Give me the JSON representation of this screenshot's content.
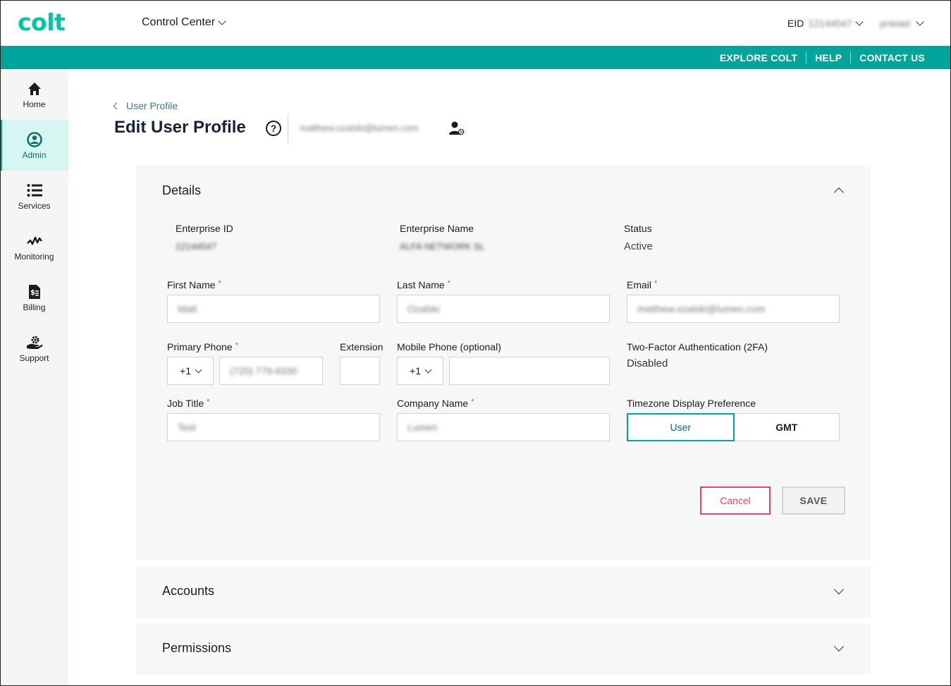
{
  "header": {
    "logo": "colt",
    "app_switcher": "Control Center",
    "eid_label": "EID",
    "eid_value": "12144547",
    "user_name": "prasad"
  },
  "top_links": [
    "EXPLORE COLT",
    "HELP",
    "CONTACT US"
  ],
  "sidebar": {
    "items": [
      {
        "label": "Home",
        "icon": "home-icon",
        "active": false
      },
      {
        "label": "Admin",
        "icon": "user-circle-icon",
        "active": true
      },
      {
        "label": "Services",
        "icon": "list-icon",
        "active": false
      },
      {
        "label": "Monitoring",
        "icon": "pulse-icon",
        "active": false
      },
      {
        "label": "Billing",
        "icon": "invoice-icon",
        "active": false
      },
      {
        "label": "Support",
        "icon": "support-icon",
        "active": false
      }
    ]
  },
  "page": {
    "breadcrumb": "User Profile",
    "title": "Edit User Profile",
    "help_glyph": "?",
    "user_email": "matthew.ozalski@lumen.com"
  },
  "details": {
    "title": "Details",
    "enterprise_id_label": "Enterprise ID",
    "enterprise_id_value": "12144547",
    "enterprise_name_label": "Enterprise Name",
    "enterprise_name_value": "ALFA NETWORK SL",
    "status_label": "Status",
    "status_value": "Active",
    "first_name_label": "First Name",
    "first_name_value": "Matt",
    "last_name_label": "Last Name",
    "last_name_value": "Ozalski",
    "email_label": "Email",
    "email_value": "matthew.ozalski@lumen.com",
    "primary_phone_label": "Primary Phone",
    "primary_phone_code": "+1",
    "primary_phone_value": "(720) 779-6330",
    "extension_label": "Extension",
    "extension_value": "",
    "mobile_phone_label": "Mobile Phone (optional)",
    "mobile_phone_code": "+1",
    "mobile_phone_value": "",
    "twofa_label": "Two-Factor Authentication (2FA)",
    "twofa_value": "Disabled",
    "job_title_label": "Job Title",
    "job_title_value": "Test",
    "company_label": "Company Name",
    "company_value": "Lumen",
    "timezone_label": "Timezone Display Preference",
    "timezone_options": [
      "User",
      "GMT"
    ],
    "timezone_selected": "User",
    "required_mark": "*",
    "cancel_label": "Cancel",
    "save_label": "SAVE"
  },
  "accounts": {
    "title": "Accounts"
  },
  "permissions": {
    "title": "Permissions"
  },
  "colors": {
    "brand_teal": "#00a49a",
    "logo_teal": "#00c6a8",
    "cancel_pink": "#e0476b",
    "active_nav_bg": "#d8f6f1"
  }
}
